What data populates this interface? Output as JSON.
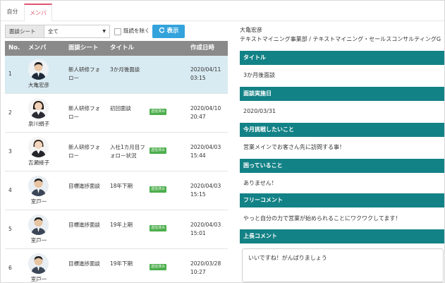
{
  "tabs": [
    {
      "label": "自分",
      "active": false
    },
    {
      "label": "メンバ",
      "active": true
    }
  ],
  "filter": {
    "select_label": "面談シート",
    "select_value": "全て",
    "exclude_read_label": "既読を除く",
    "show_button": "表示"
  },
  "table": {
    "headers": [
      "No.",
      "メンバ",
      "面談シート",
      "タイトル",
      "作成日時"
    ],
    "rows": [
      {
        "no": "1",
        "member": "大亀宏彦",
        "sheet": "新人研修フォロー",
        "title": "3か月後面談",
        "badge": "",
        "date": "2020/04/11",
        "time": "03:15",
        "active": true
      },
      {
        "no": "2",
        "member": "泉川絹子",
        "sheet": "新人研修フォロー",
        "title": "初回面談",
        "badge": "送信済み",
        "date": "2020/04/10",
        "time": "20:47",
        "active": false
      },
      {
        "no": "3",
        "member": "吉瀬綾子",
        "sheet": "新人研修フォロー",
        "title": "入社1カ月目フォロー状況",
        "badge": "送信済み",
        "date": "2020/04/03",
        "time": "15:44",
        "active": false
      },
      {
        "no": "4",
        "member": "室戸一",
        "sheet": "目標進捗面談",
        "title": "18年下期",
        "badge": "送信済み",
        "date": "2020/04/03",
        "time": "15:15",
        "active": false
      },
      {
        "no": "5",
        "member": "室戸一",
        "sheet": "目標進捗面談",
        "title": "19年上期",
        "badge": "送信済み",
        "date": "2020/04/03",
        "time": "15:01",
        "active": false
      },
      {
        "no": "6",
        "member": "室戸一",
        "sheet": "目標進捗面談",
        "title": "19年下期",
        "badge": "送信済み",
        "date": "2020/03/28",
        "time": "10:27",
        "active": false
      }
    ]
  },
  "detail": {
    "name": "大亀宏彦",
    "org": "テキストマイニング事業部 / テキストマイニング・セールスコンサルティングG",
    "sections": [
      {
        "heading": "タイトル",
        "body": "3か月後面談"
      },
      {
        "heading": "面談実施日",
        "body": "2020/03/31"
      },
      {
        "heading": "今月挑戦したいこと",
        "body": "営業メインでお客さん先に訪問する事！"
      },
      {
        "heading": "困っていること",
        "body": "ありません！"
      },
      {
        "heading": "フリーコメント",
        "body": "やっと自分の力で営業が始められることにワクワクしてます！"
      },
      {
        "heading": "上長コメント",
        "body": ""
      }
    ],
    "boss_comment_value": "いいですね！がんばりましょう"
  },
  "colors": {
    "accent_pink": "#e0556f",
    "button_blue": "#33a3dc",
    "header_gray": "#8a8a8a",
    "section_teal": "#138286",
    "badge_green": "#4cae4c",
    "active_row": "#d9ebf2"
  },
  "icons": {
    "refresh": "refresh-icon",
    "caret": "caret-down-icon"
  }
}
